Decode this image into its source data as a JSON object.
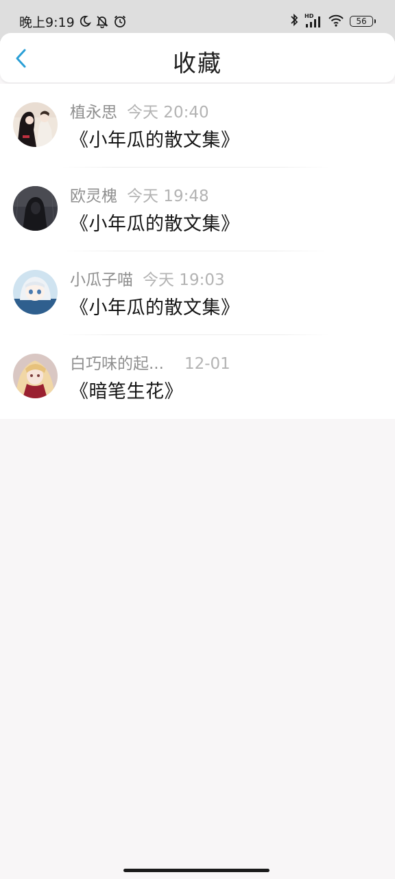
{
  "status_bar": {
    "time": "晚上9:19",
    "battery": "56",
    "network": "HD"
  },
  "header": {
    "title": "收藏"
  },
  "colors": {
    "accent": "#2a9fd6",
    "page_background": "#f8f6f7",
    "status_bar": "#dedede"
  },
  "favorites": [
    {
      "user": "植永思",
      "time": "今天 20:40",
      "book": "《小年瓜的散文集》"
    },
    {
      "user": "欧灵槐",
      "time": "今天 19:48",
      "book": "《小年瓜的散文集》"
    },
    {
      "user": "小瓜子喵",
      "time": "今天 19:03",
      "book": "《小年瓜的散文集》"
    },
    {
      "user": "白巧味的起...",
      "time": "12-01",
      "book": "《暗笔生花》"
    }
  ]
}
